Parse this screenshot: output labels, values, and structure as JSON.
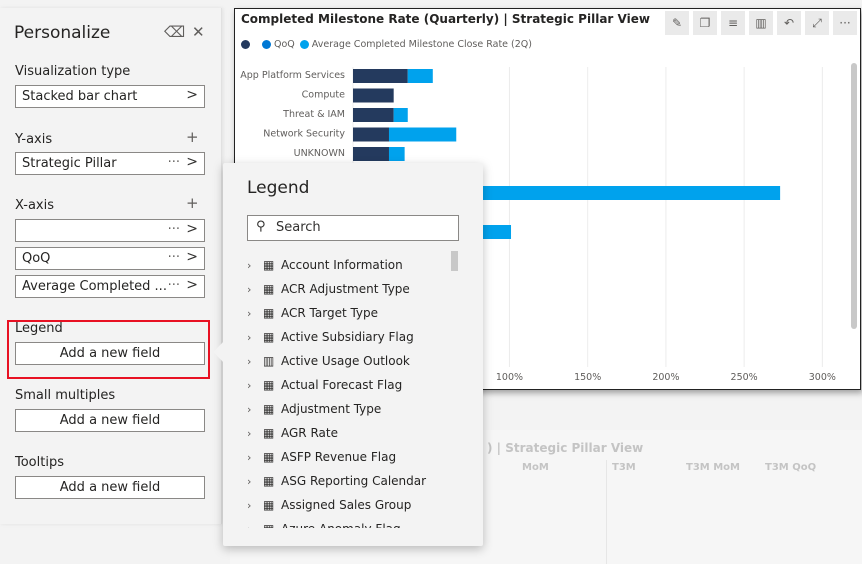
{
  "personalize": {
    "title": "Personalize",
    "viz_label": "Visualization type",
    "viz_value": "Stacked bar chart",
    "yaxis_label": "Y-axis",
    "yaxis_field": "Strategic Pillar",
    "xaxis_label": "X-axis",
    "xaxis_fields": [
      "",
      "QoQ",
      "Average Completed ..."
    ],
    "legend_label": "Legend",
    "small_multiples_label": "Small multiples",
    "tooltips_label": "Tooltips",
    "add_field": "Add a new field",
    "more": "···",
    "chevron": ">",
    "plus": "+",
    "eraser_icon": "eraser-icon",
    "close_icon": "close-icon"
  },
  "visual": {
    "title": "Completed Milestone Rate (Quarterly) | Strategic Pillar View",
    "toolbar": [
      "pin-icon",
      "copy-icon",
      "filter-icon",
      "format-icon",
      "undo-icon",
      "focus-mode-icon",
      "more-icon"
    ],
    "legend": [
      {
        "name": "",
        "color": "#243a5e"
      },
      {
        "name": "QoQ",
        "color": "#0078d4"
      },
      {
        "name": "Average Completed Milestone Close Rate (2Q)",
        "color": "#00a2ed"
      }
    ]
  },
  "chart_data": {
    "type": "bar",
    "orientation": "horizontal",
    "stacked": true,
    "categories": [
      "App Platform Services",
      "Compute",
      "Threat & IAM",
      "Network Security",
      "UNKNOWN",
      "",
      "",
      "",
      ""
    ],
    "series": [
      {
        "name": "",
        "color": "#243a5e",
        "values": [
          35,
          26,
          26,
          23,
          23,
          0,
          0,
          0,
          0
        ]
      },
      {
        "name": "Average Completed Milestone Close Rate (2Q)",
        "color": "#00a2ed",
        "values": [
          16,
          0,
          9,
          43,
          10,
          0,
          273,
          0,
          101
        ]
      }
    ],
    "x_ticks": [
      "100%",
      "150%",
      "200%",
      "250%",
      "300%"
    ],
    "x_tick_values": [
      100,
      150,
      200,
      250,
      300
    ],
    "xlim": [
      0,
      310
    ],
    "grid": true
  },
  "background_visual": {
    "title": ") | Strategic Pillar View",
    "columns": [
      "MoM",
      "T3M",
      "T3M MoM",
      "T3M QoQ"
    ]
  },
  "legend_popup": {
    "title": "Legend",
    "search_placeholder": "Search",
    "items": [
      {
        "label": "Account Information",
        "icon": "table"
      },
      {
        "label": "ACR Adjustment Type",
        "icon": "table"
      },
      {
        "label": "ACR Target Type",
        "icon": "table"
      },
      {
        "label": "Active Subsidiary Flag",
        "icon": "table"
      },
      {
        "label": "Active Usage Outlook",
        "icon": "calculator"
      },
      {
        "label": "Actual Forecast Flag",
        "icon": "table"
      },
      {
        "label": "Adjustment Type",
        "icon": "table"
      },
      {
        "label": "AGR Rate",
        "icon": "table"
      },
      {
        "label": "ASFP Revenue Flag",
        "icon": "table"
      },
      {
        "label": "ASG Reporting Calendar",
        "icon": "table"
      },
      {
        "label": "Assigned Sales Group",
        "icon": "table"
      },
      {
        "label": "Azure Anomaly Flag",
        "icon": "table"
      }
    ]
  }
}
